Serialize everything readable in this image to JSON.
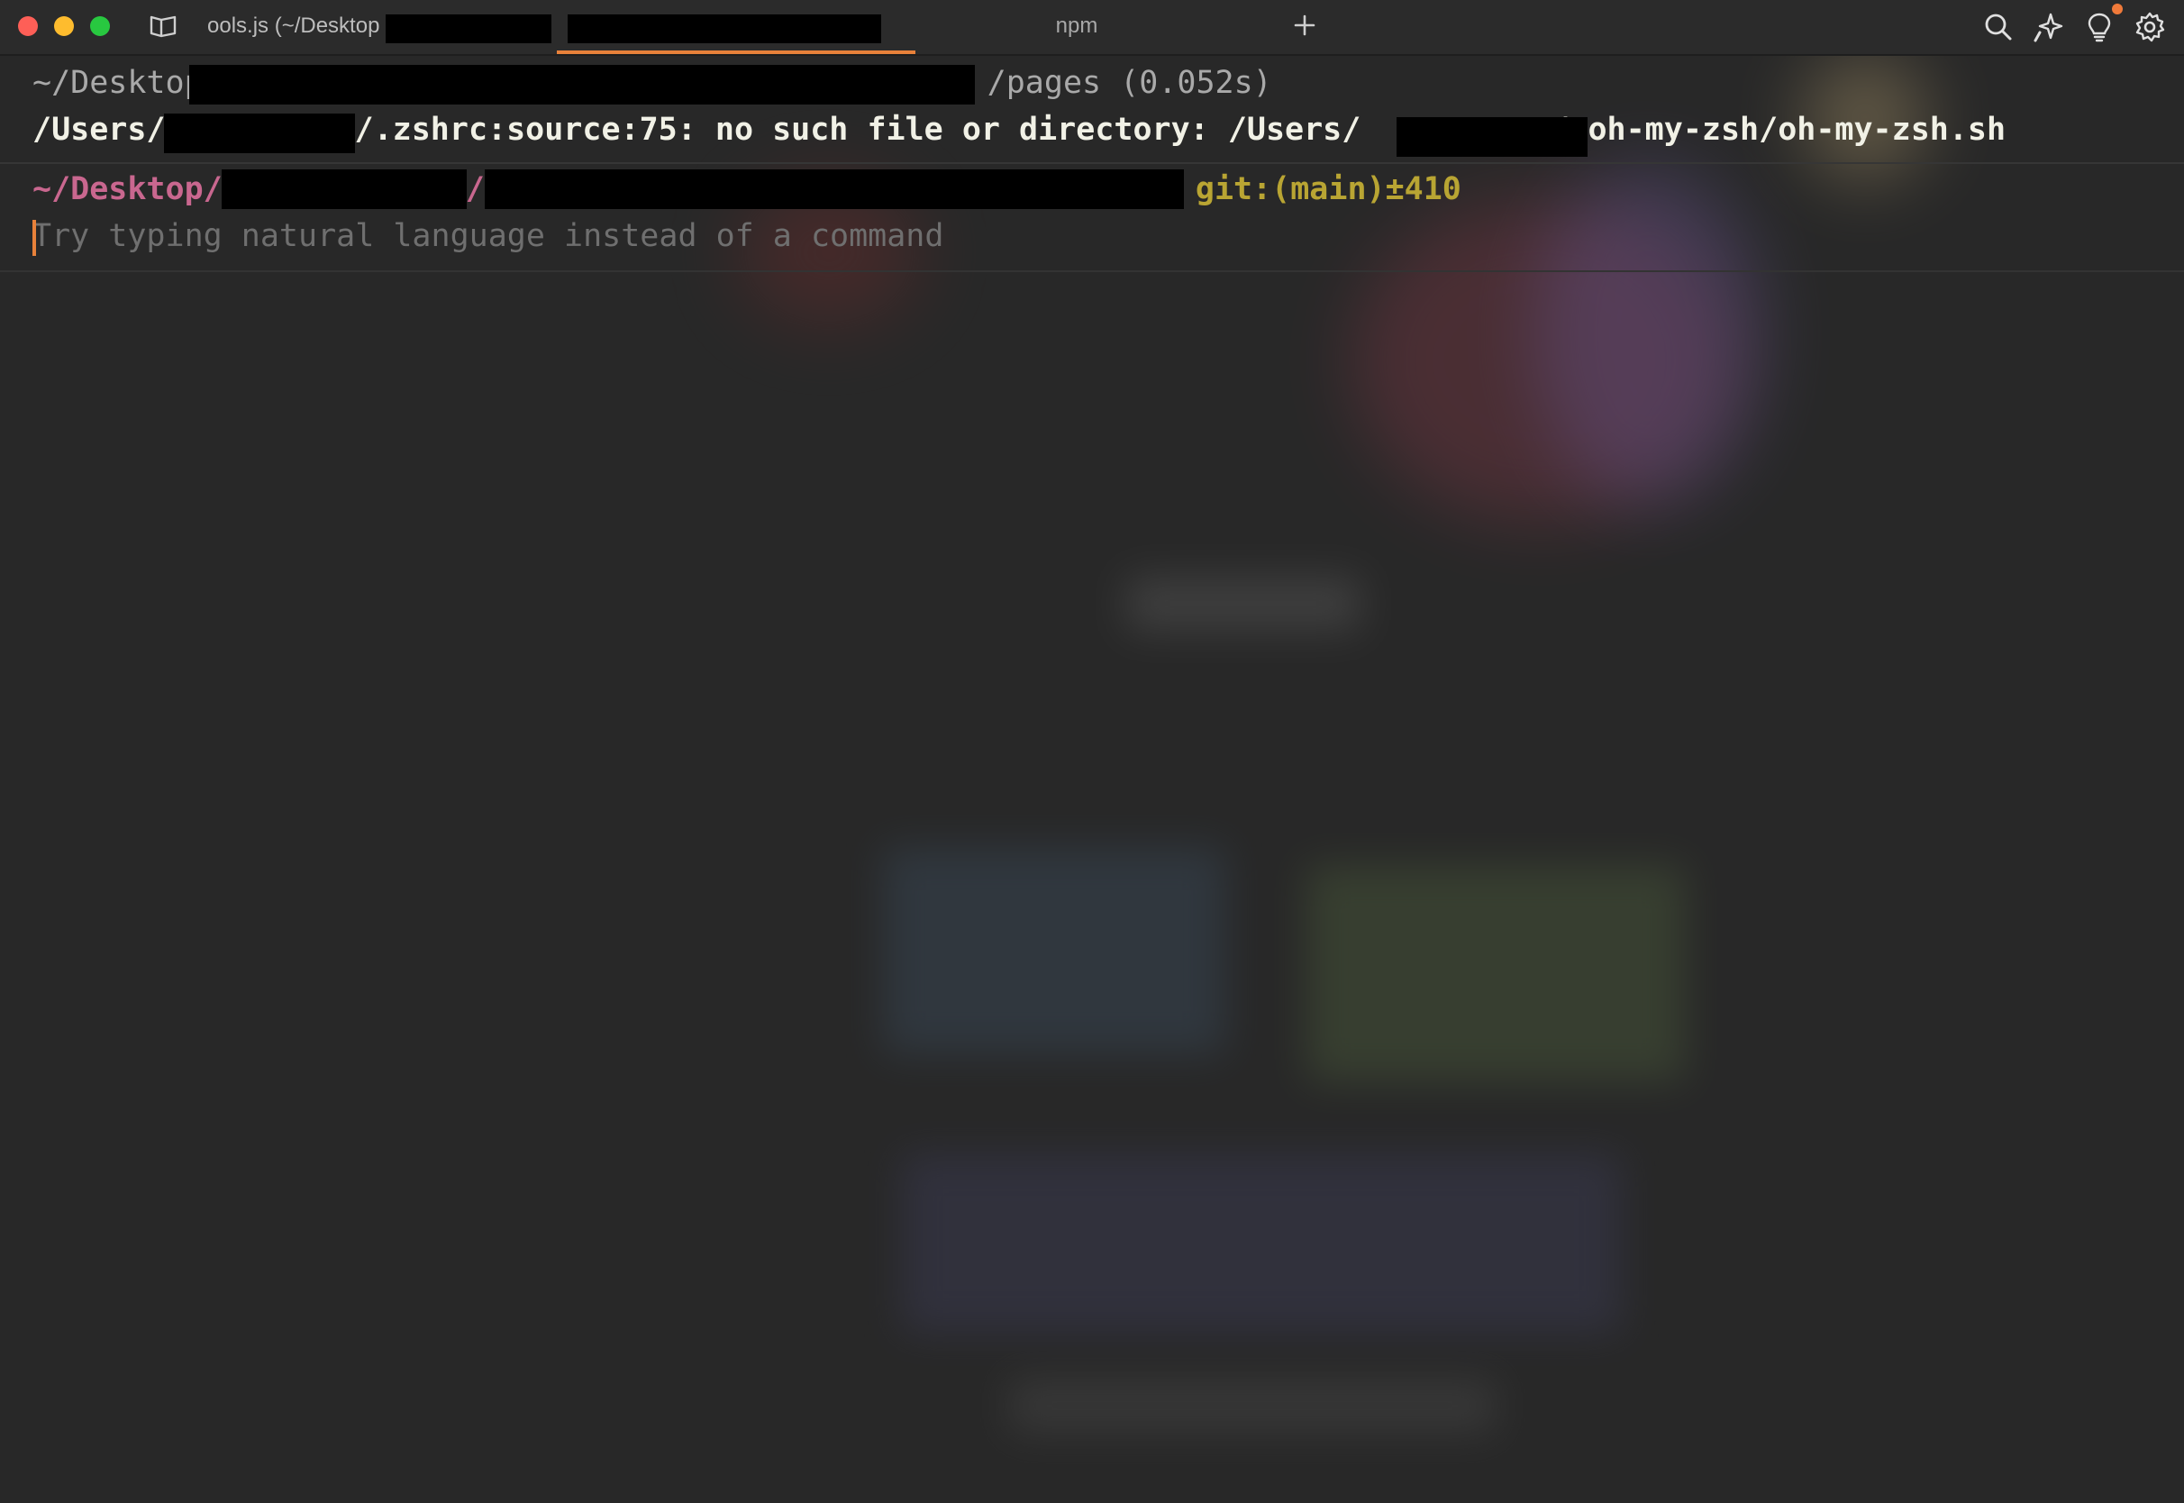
{
  "window": {
    "traffic_lights": [
      "close",
      "minimize",
      "zoom"
    ]
  },
  "tabs": [
    {
      "label": "ools.js (~/Desktop",
      "active": false
    },
    {
      "label": "",
      "active": true
    },
    {
      "label": "npm",
      "active": false
    }
  ],
  "toolbar": {
    "icons": [
      "search-icon",
      "ai-sparkle-icon",
      "lightbulb-icon",
      "gear-icon"
    ],
    "accent": "#e8813a"
  },
  "terminal": {
    "block1": {
      "command_prefix": "~/Desktop",
      "command_suffix": "/pages (0.052s)",
      "error_prefix": "/Users/",
      "error_middle": "/.zshrc:source:75: no such file or directory: /Users/",
      "error_suffix": "/.oh-my-zsh/oh-my-zsh.sh"
    },
    "prompt": {
      "path_prefix": "~/Desktop/",
      "path_sep": "/(",
      "git": "git:(main)±410"
    },
    "input": {
      "placeholder": "Try typing natural language instead of a command"
    }
  }
}
